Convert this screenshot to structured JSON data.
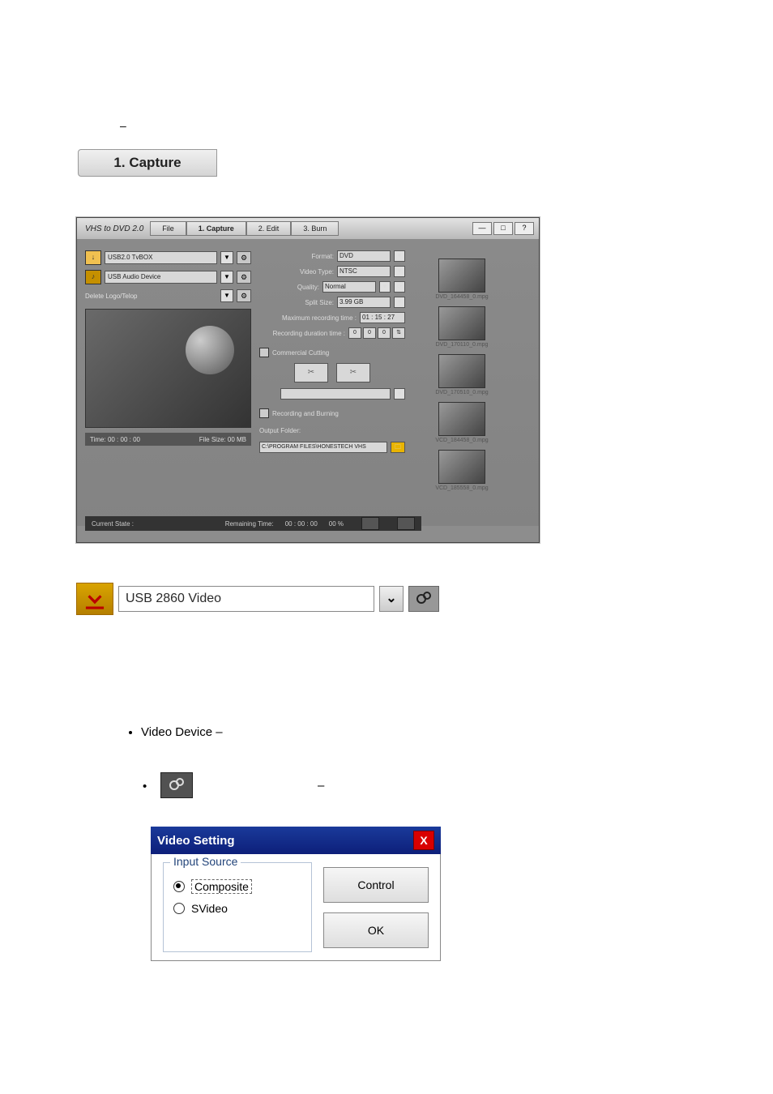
{
  "section_number": "",
  "phase_dash": "–",
  "capture_tab_label": "1. Capture",
  "app": {
    "title": "VHS to DVD 2.0",
    "file_label": "File",
    "tabs": [
      "1. Capture",
      "2. Edit",
      "3. Burn"
    ],
    "winctl": [
      "—",
      "□",
      "?"
    ],
    "left": {
      "video_dev": "USB2.0 TvBOX",
      "audio_dev": "USB Audio Device",
      "delete_label": "Delete Logo/Telop",
      "time_label": "Time:",
      "time_val": "00 : 00 : 00",
      "size_label": "File Size:",
      "size_val": "00 MB"
    },
    "mid": {
      "format_lbl": "Format:",
      "format_val": "DVD",
      "vtype_lbl": "Video Type:",
      "vtype_val": "NTSC",
      "quality_lbl": "Quality:",
      "quality_val": "Normal",
      "split_lbl": "Split Size:",
      "split_val": "3.99 GB",
      "maxrec_lbl": "Maximum recording time :",
      "maxrec_val": "01 : 15 : 27",
      "dur_lbl": "Recording duration time :",
      "dur_vals": [
        "0",
        "0",
        "0"
      ],
      "cc_label": "Commercial Cutting",
      "rb_label": "Recording and Burning",
      "outfolder_lbl": "Output Folder:",
      "outfolder_val": "C:\\PROGRAM FILES\\HONESTECH VHS"
    },
    "thumbs": [
      "DVD_164458_0.mpg",
      "DVD_170110_0.mpg",
      "DVD_170510_0.mpg",
      "VCD_184458_0.mpg",
      "VCD_185558_0.mpg"
    ],
    "status": {
      "state_lbl": "Current State :",
      "rem_lbl": "Remaining Time:",
      "rem_val": "00 : 00 : 00",
      "pct": "00 %"
    }
  },
  "vdev": {
    "value": "USB 2860 Video"
  },
  "bullets": {
    "item1": "Video Device –",
    "dashA": "–"
  },
  "vsetting": {
    "title": "Video Setting",
    "legend": "Input Source",
    "opt1": "Composite",
    "opt2": "SVideo",
    "btn1": "Control",
    "btn2": "OK"
  }
}
